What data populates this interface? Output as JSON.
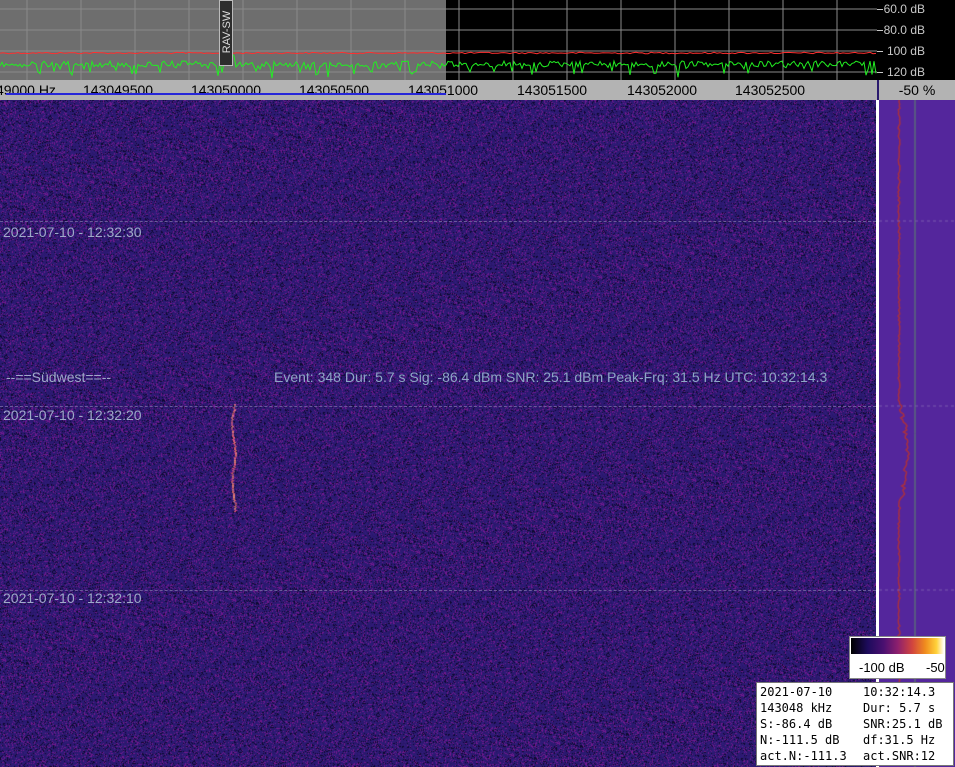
{
  "spectrum": {
    "db_labels": [
      "60.0 dB",
      "80.0 dB",
      "100 dB",
      "120 dB"
    ],
    "marker_label": "RAV-SW",
    "colors": {
      "spectrum_trace": "#22ee22",
      "average_trace": "#ff3030",
      "active_area": "#6e6e6e"
    }
  },
  "freq_axis": {
    "labels": [
      "49000 Hz",
      "143049500",
      "143050000",
      "143050500",
      "143051000",
      "143051500",
      "143052000",
      "143052500"
    ],
    "percent": "-50 %"
  },
  "waterfall": {
    "time_labels": [
      "2021-07-10 - 12:32:30",
      "2021-07-10 - 12:32:20",
      "2021-07-10 - 12:32:10"
    ],
    "station": "--==Südwest==--",
    "event_text": "Event: 348   Dur: 5.7 s   Sig: -86.4 dBm   SNR: 25.1 dBm   Peak-Frq: 31.5 Hz   UTC: 10:32:14.3"
  },
  "colorbar": {
    "min_label": "-100 dB",
    "max_label": "-50"
  },
  "info": {
    "rows": [
      [
        "2021-07-10",
        "10:32:14.3"
      ],
      [
        "143048 kHz",
        "Dur: 5.7 s"
      ],
      [
        "S:-86.4 dB",
        "SNR:25.1 dB"
      ],
      [
        "N:-111.5 dB",
        "df:31.5 Hz"
      ],
      [
        "act.N:-111.3",
        "act.SNR:12"
      ]
    ]
  }
}
